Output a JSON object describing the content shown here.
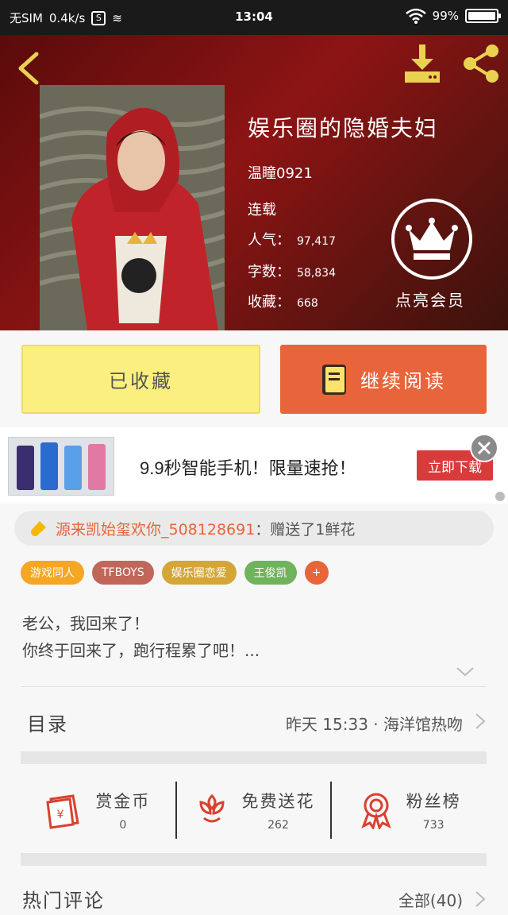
{
  "status_bar": {
    "carrier": "无SIM",
    "speed": "0.4k/s",
    "time": "13:04",
    "battery": "99%",
    "battery_level": 0.99
  },
  "book": {
    "title": "娱乐圈的隐婚夫妇",
    "author": "温瞳0921",
    "status": "连载",
    "popularity_label": "人气：",
    "popularity": "97,417",
    "words_label": "字数：",
    "words": "58,834",
    "favorites_label": "收藏：",
    "favorites": "668",
    "vip_label": "点亮会员"
  },
  "actions": {
    "favorited_label": "已收藏",
    "continue_label": "继续阅读"
  },
  "ad": {
    "text": "9.9秒智能手机！限量速抢！",
    "cta": "立即下载"
  },
  "gift": {
    "user": "源来凯始玺欢你_508128691",
    "rest": "：赠送了1鲜花"
  },
  "tags": [
    {
      "label": "游戏同人",
      "color": "#f5a623"
    },
    {
      "label": "TFBOYS",
      "color": "#c0675a"
    },
    {
      "label": "娱乐圈恋爱",
      "color": "#d4a637"
    },
    {
      "label": "王俊凯",
      "color": "#6fb45c"
    },
    {
      "label": "+",
      "color": "#e8643a"
    }
  ],
  "description": {
    "line1": "老公，我回来了！",
    "line2": "你终于回来了，跑行程累了吧！..."
  },
  "toc": {
    "label": "目录",
    "latest": "昨天 15:33 · 海洋馆热吻"
  },
  "rewards": [
    {
      "label": "赏金币",
      "value": "0",
      "icon": "red-envelope-icon"
    },
    {
      "label": "免费送花",
      "value": "262",
      "icon": "flower-icon"
    },
    {
      "label": "粉丝榜",
      "value": "733",
      "icon": "medal-icon"
    }
  ],
  "comments": {
    "label": "热门评论",
    "all": "全部(40)"
  },
  "colors": {
    "accent": "#e8643a",
    "favorite_button": "#fbef7f",
    "icon_gold": "#e9d24f",
    "icon_red": "#d9412f"
  }
}
